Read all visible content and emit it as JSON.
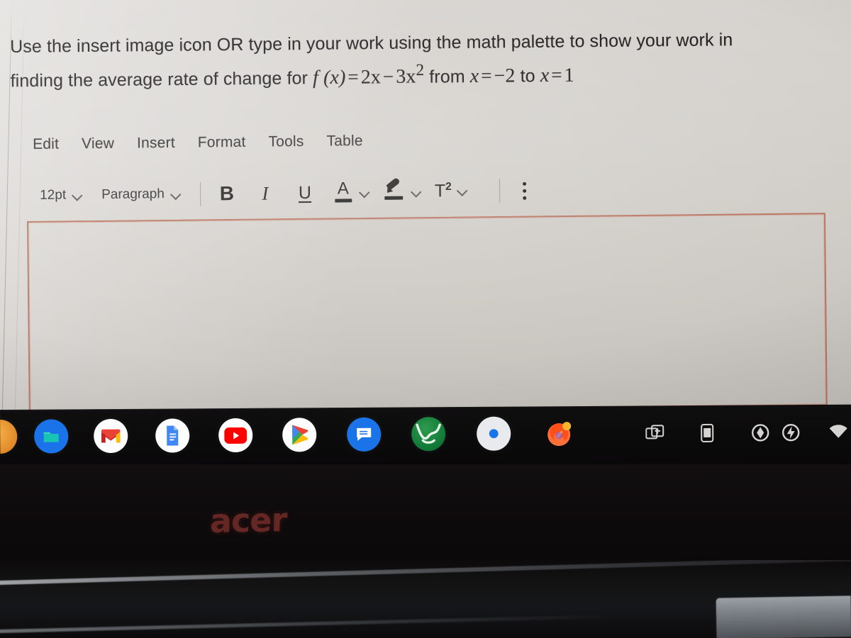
{
  "assignment": {
    "prompt_line1": "Use the insert image icon  OR type in your work using the math palette to show your work in",
    "prompt_line2_prefix": "finding the average rate of change for",
    "math": {
      "function_name": "f",
      "variable": "x",
      "fx_label": "f (x)",
      "equals": "=",
      "term1": "2x",
      "minus": "−",
      "term2_base": "3x",
      "term2_exp": "2",
      "from_label": "from",
      "x_lower_label": "x",
      "x_lower_value": "−2",
      "to_label": "to",
      "x_upper_label": "x",
      "x_upper_value": "1",
      "full_expression": "f(x) = 2x − 3x² from x = −2 to x = 1"
    }
  },
  "editor": {
    "menubar": [
      {
        "label": "Edit",
        "name": "menu-edit"
      },
      {
        "label": "View",
        "name": "menu-view"
      },
      {
        "label": "Insert",
        "name": "menu-insert"
      },
      {
        "label": "Format",
        "name": "menu-format"
      },
      {
        "label": "Tools",
        "name": "menu-tools"
      },
      {
        "label": "Table",
        "name": "menu-table"
      }
    ],
    "toolbar": {
      "font_size_value": "12pt",
      "block_format_value": "Paragraph",
      "bold_label": "B",
      "italic_label": "I",
      "underline_label": "U",
      "text_color_glyph": "A",
      "superscript_label": "T",
      "superscript_exponent": "2",
      "more_options_label": "⋮"
    },
    "content_area": {
      "value": "",
      "placeholder": "",
      "border_color": "#b87460"
    }
  },
  "shelf": {
    "apps": [
      {
        "name": "launcher-icon",
        "label": "Launcher",
        "color": "#f2a33c"
      },
      {
        "name": "files-app-icon",
        "label": "Files",
        "color": "#1a73e8"
      },
      {
        "name": "gmail-app-icon",
        "label": "Gmail",
        "color": "#ffffff"
      },
      {
        "name": "google-docs-app-icon",
        "label": "Docs",
        "color": "#ffffff"
      },
      {
        "name": "youtube-app-icon",
        "label": "YouTube",
        "color": "#ffffff"
      },
      {
        "name": "play-store-app-icon",
        "label": "Play Store",
        "color": "#ffffff"
      },
      {
        "name": "messages-app-icon",
        "label": "Messages",
        "color": "#1a73e8"
      },
      {
        "name": "desmos-app-icon",
        "label": "Desmos",
        "color": "#127a39"
      },
      {
        "name": "settings-app-icon",
        "label": "Settings",
        "color": "#e8eaed"
      },
      {
        "name": "firefox-app-icon",
        "label": "Firefox",
        "color": "#ff7139"
      }
    ],
    "tray": [
      {
        "name": "screen-capture-icon",
        "label": "Screen capture"
      },
      {
        "name": "phone-hub-icon",
        "label": "Phone Hub"
      },
      {
        "name": "battery-status-icon",
        "label": "Battery"
      },
      {
        "name": "battery-saver-icon",
        "label": "Charging"
      },
      {
        "name": "wifi-icon",
        "label": "Wi-Fi"
      }
    ]
  },
  "device": {
    "brand_logo": "acer",
    "brand_logo_color": "#6d2a27"
  }
}
